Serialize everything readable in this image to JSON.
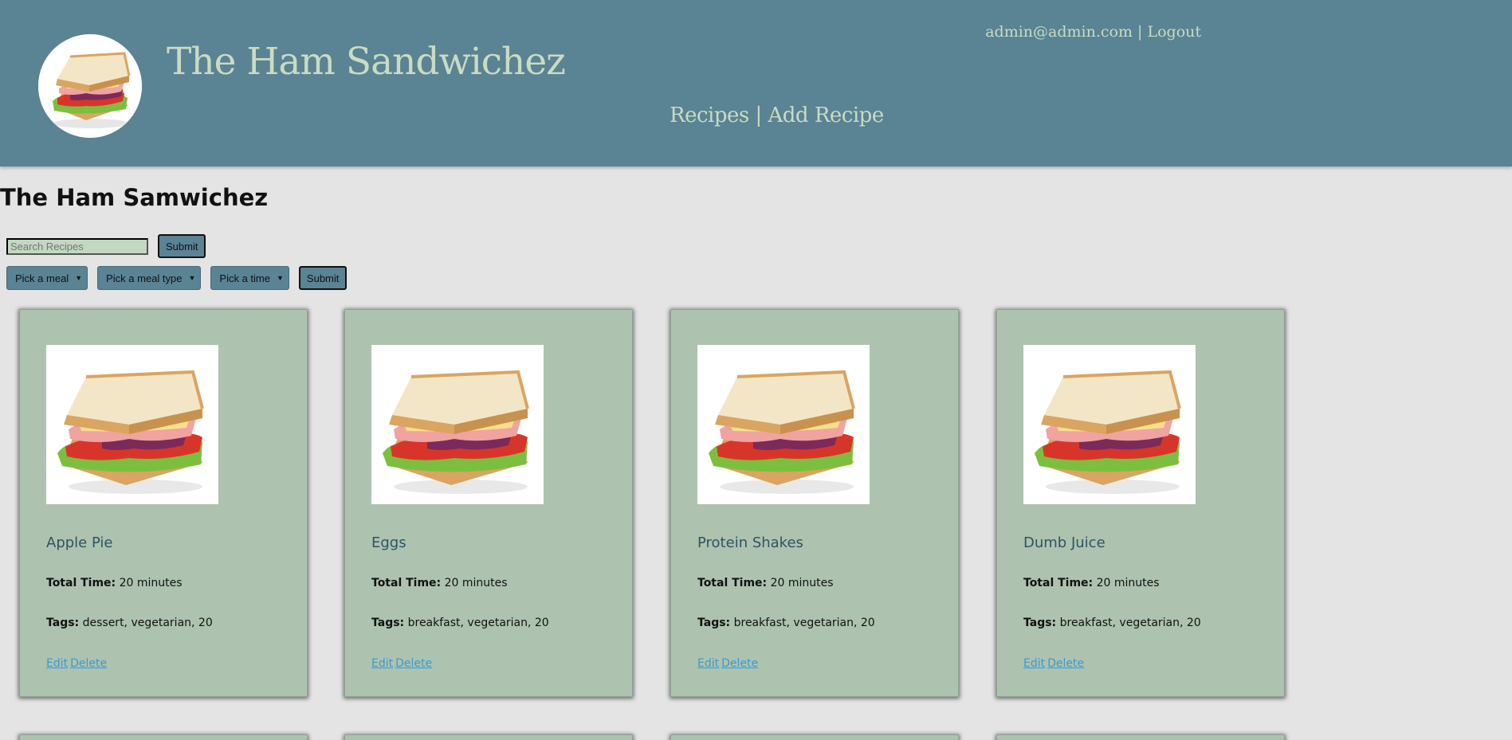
{
  "header": {
    "site_title": "The Ham Sandwichez",
    "user_email": "admin@admin.com",
    "separator": " | ",
    "logout_label": "Logout",
    "nav_recipes": "Recipes",
    "nav_add_recipe": "Add Recipe"
  },
  "page": {
    "heading": "The Ham Samwichez"
  },
  "search": {
    "placeholder": "Search Recipes",
    "submit_label": "Submit"
  },
  "filters": {
    "meal_label": "Pick a meal",
    "meal_type_label": "Pick a meal type",
    "time_label": "Pick a time",
    "submit_label": "Submit"
  },
  "labels": {
    "total_time": "Total Time:",
    "tags": "Tags:",
    "edit": "Edit",
    "delete": "Delete"
  },
  "recipes": [
    {
      "name": "Apple Pie",
      "total_time": "20 minutes",
      "tags": "dessert, vegetarian, 20"
    },
    {
      "name": "Eggs",
      "total_time": "20 minutes",
      "tags": "breakfast, vegetarian, 20"
    },
    {
      "name": "Protein Shakes",
      "total_time": "20 minutes",
      "tags": "breakfast, vegetarian, 20"
    },
    {
      "name": "Dumb Juice",
      "total_time": "20 minutes",
      "tags": "breakfast, vegetarian, 20"
    }
  ],
  "colors": {
    "header_bg": "#5a8394",
    "header_text": "#c9dcc1",
    "page_bg": "#e4e4e4",
    "card_bg": "#adc3af",
    "card_title": "#2f5363",
    "link": "#3a9ad0"
  },
  "icons": {
    "logo": "sandwich-logo-icon",
    "recipe_image": "sandwich-image-icon",
    "select_arrow": "chevron-down-icon"
  }
}
